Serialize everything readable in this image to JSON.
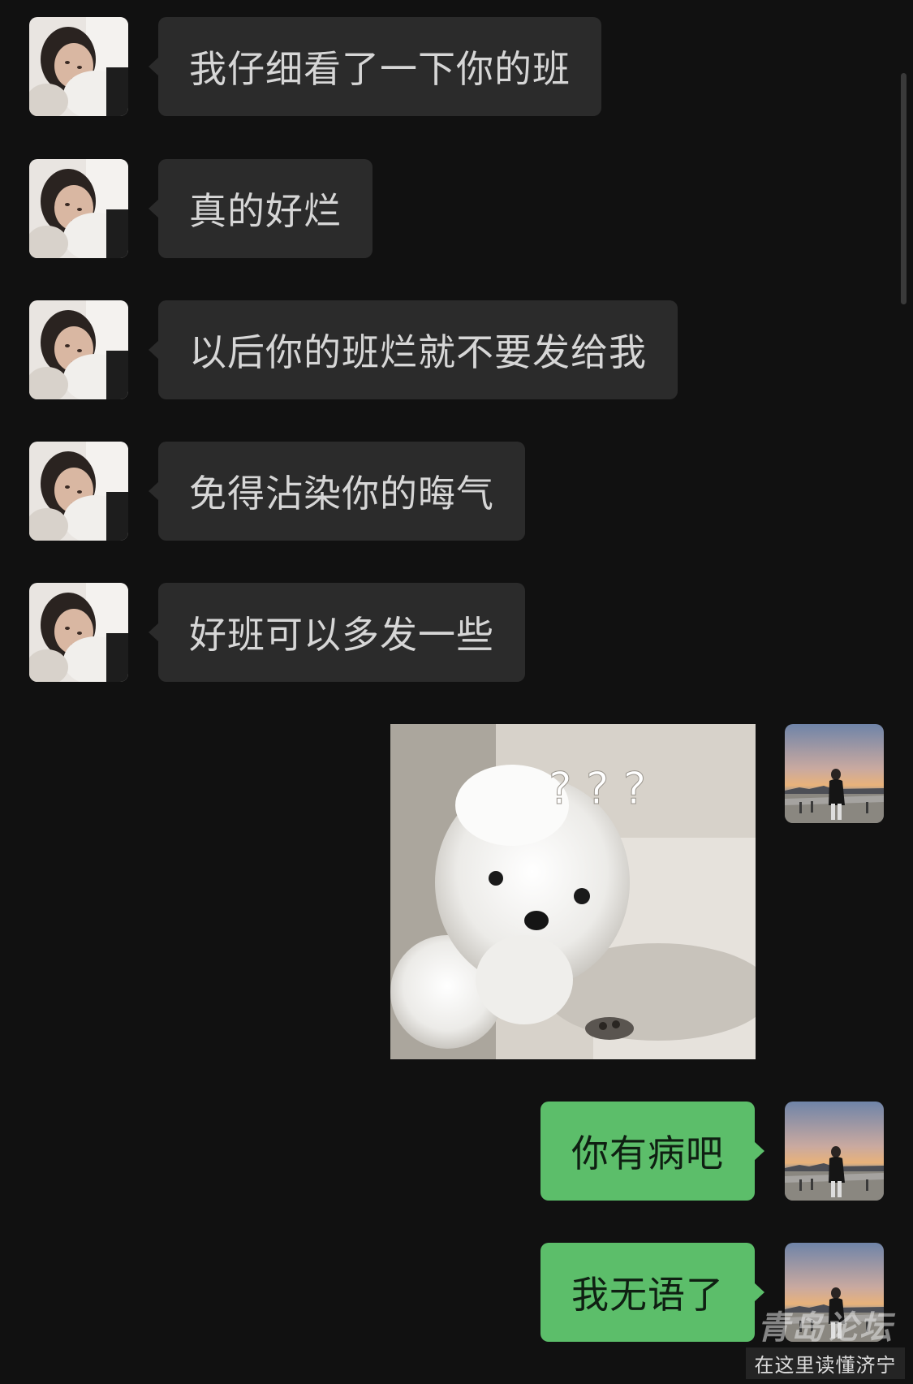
{
  "app": {
    "accent_color": "#5cbe6a",
    "background": "#111111"
  },
  "messages": [
    {
      "side": "incoming",
      "sender": "contact",
      "type": "text",
      "text": "我仔细看了一下你的班"
    },
    {
      "side": "incoming",
      "sender": "contact",
      "type": "text",
      "text": "真的好烂"
    },
    {
      "side": "incoming",
      "sender": "contact",
      "type": "text",
      "text": "以后你的班烂就不要发给我"
    },
    {
      "side": "incoming",
      "sender": "contact",
      "type": "text",
      "text": "免得沾染你的晦气"
    },
    {
      "side": "incoming",
      "sender": "contact",
      "type": "text",
      "text": "好班可以多发一些"
    },
    {
      "side": "outgoing",
      "sender": "me",
      "type": "sticker",
      "sticker": "confused-white-puppy-sticker",
      "text": "? ? ?"
    },
    {
      "side": "outgoing",
      "sender": "me",
      "type": "text",
      "text": "你有病吧"
    },
    {
      "side": "outgoing",
      "sender": "me",
      "type": "text",
      "text": "我无语了"
    }
  ],
  "watermark": {
    "logo": "青岛论坛",
    "tagline": "在这里读懂济宁"
  },
  "icons": {
    "contact_avatar": "woman-with-dog-avatar",
    "my_avatar": "seaside-sunset-avatar"
  }
}
